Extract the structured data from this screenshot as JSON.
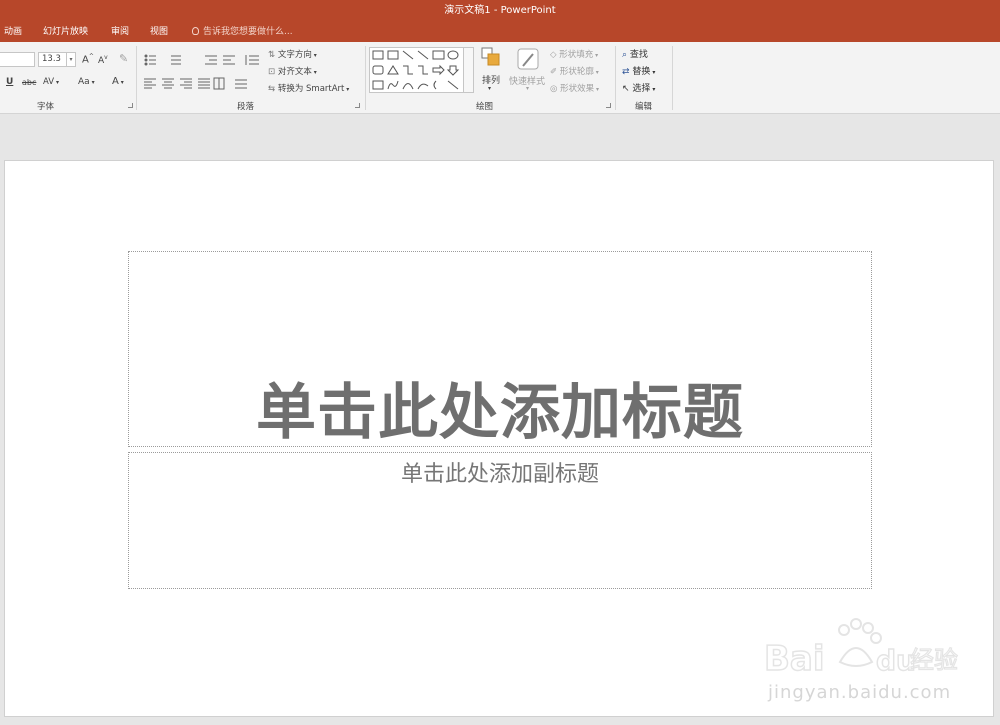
{
  "window": {
    "title": "演示文稿1 - PowerPoint"
  },
  "tabs": [
    {
      "label": "动画"
    },
    {
      "label": "幻灯片放映"
    },
    {
      "label": "审阅"
    },
    {
      "label": "视图"
    }
  ],
  "tell_me": {
    "placeholder": "告诉我您想要做什么..."
  },
  "ribbon": {
    "font_group": {
      "label": "字体",
      "font_size": "13.3",
      "buttons": [
        "U",
        "abc",
        "AV",
        "Aa",
        "A"
      ]
    },
    "paragraph_group": {
      "label": "段落",
      "text_direction": "文字方向",
      "align_text": "对齐文本",
      "convert_smartart": "转换为 SmartArt"
    },
    "drawing_group": {
      "label": "绘图",
      "arrange": "排列",
      "quick_styles": "快速样式",
      "shape_fill": "形状填充",
      "shape_outline": "形状轮廓",
      "shape_effects": "形状效果"
    },
    "editing_group": {
      "label": "编辑",
      "find": "查找",
      "replace": "替换",
      "select": "选择"
    }
  },
  "slide": {
    "title_placeholder": "单击此处添加标题",
    "subtitle_placeholder": "单击此处添加副标题"
  },
  "watermark": {
    "brand": "Bai du 经验",
    "url": "jingyan.baidu.com"
  },
  "colors": {
    "accent": "#b7472a",
    "ribbon_bg": "#f3f3f3",
    "workspace_bg": "#e6e6e6",
    "title_text": "#6f6f6f"
  }
}
